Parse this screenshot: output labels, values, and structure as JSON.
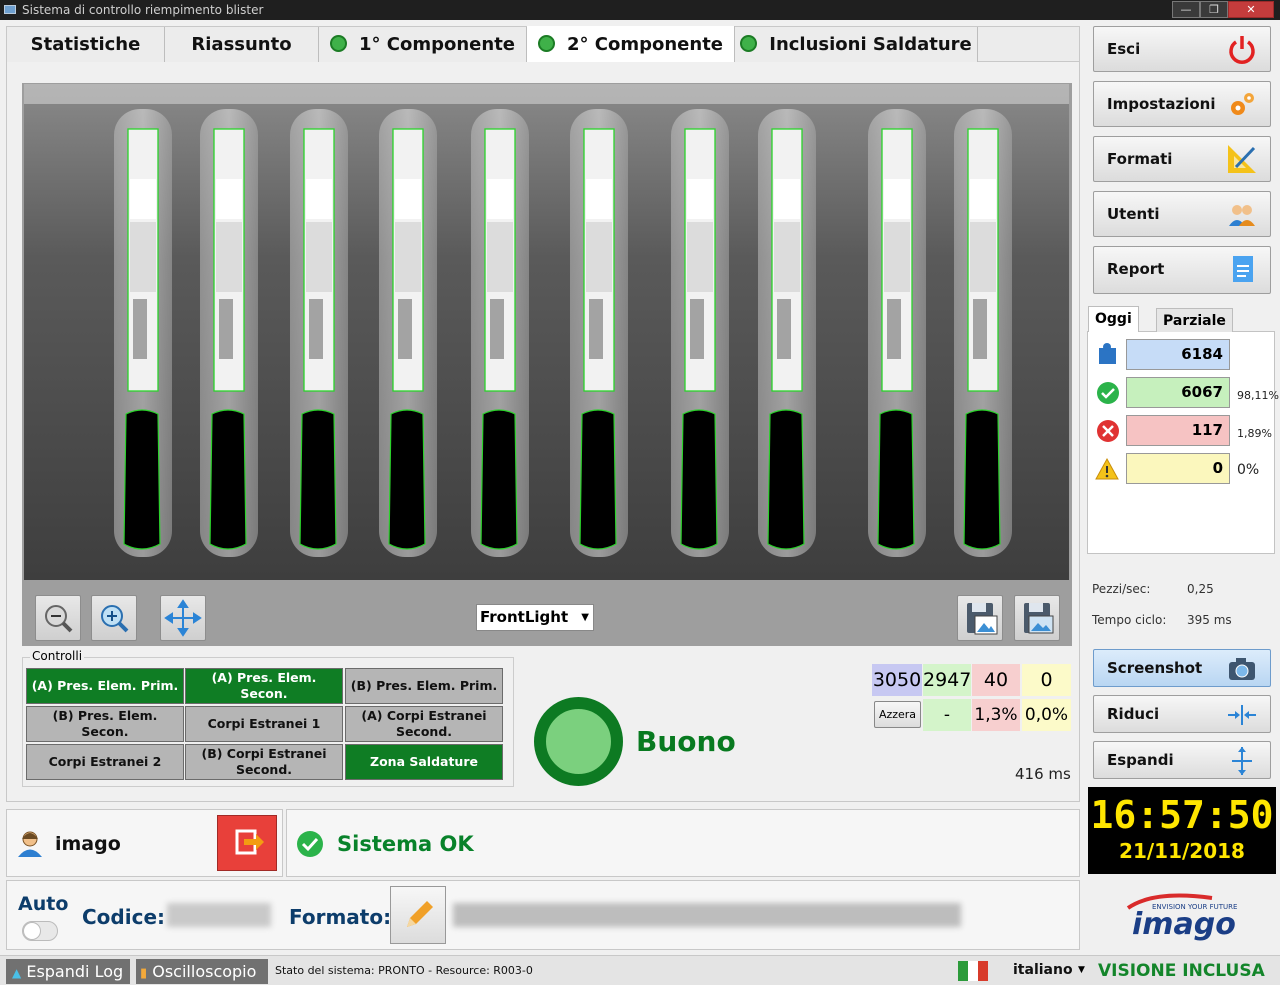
{
  "window": {
    "title": "Sistema di controllo riempimento blister"
  },
  "tabs": [
    {
      "label": "Statistiche",
      "status": "none"
    },
    {
      "label": "Riassunto",
      "status": "none"
    },
    {
      "label": "1° Componente",
      "status": "ok"
    },
    {
      "label": "2° Componente",
      "status": "ok",
      "active": true
    },
    {
      "label": "Inclusioni Saldature",
      "status": "ok"
    }
  ],
  "viewer": {
    "light_select": "FrontLight",
    "tools": [
      "zoom-out-icon",
      "zoom-in-icon",
      "fit-icon",
      "save-image-icon",
      "save-all-icon"
    ]
  },
  "controlli": {
    "title": "Controlli",
    "items": [
      {
        "label": "(A) Pres. Elem. Prim.",
        "state": "active"
      },
      {
        "label": "(A) Pres. Elem. Secon.",
        "state": "active"
      },
      {
        "label": "(B) Pres. Elem. Prim.",
        "state": "inactive"
      },
      {
        "label": "(B) Pres. Elem. Secon.",
        "state": "inactive"
      },
      {
        "label": "Corpi Estranei 1",
        "state": "inactive"
      },
      {
        "label": "(A) Corpi Estranei Second.",
        "state": "inactive"
      },
      {
        "label": "Corpi Estranei 2",
        "state": "inactive"
      },
      {
        "label": "(B) Corpi Estranei Second.",
        "state": "inactive"
      },
      {
        "label": "Zona Saldature",
        "state": "active"
      }
    ]
  },
  "result": {
    "label": "Buono",
    "color": "#0d7a22"
  },
  "counters": {
    "total": "3050",
    "good": "2947",
    "bad": "40",
    "warn": "0",
    "reset_label": "Azzera",
    "good_pct": "-",
    "bad_pct": "1,3%",
    "warn_pct": "0,0%",
    "time": "416 ms"
  },
  "user": {
    "name": "imago"
  },
  "system": {
    "status": "Sistema OK"
  },
  "codice": {
    "auto_label": "Auto",
    "codice_label": "Codice:",
    "formato_label": "Formato:"
  },
  "statusbar": {
    "log_label": "Espandi Log",
    "osc_label": "Oscilloscopio",
    "status_text": "Stato del sistema: PRONTO - Resource: R003-0",
    "language": "italiano",
    "edition": "VISIONE INCLUSA"
  },
  "sidebar": {
    "buttons": [
      {
        "label": "Esci",
        "icon": "power-icon"
      },
      {
        "label": "Impostazioni",
        "icon": "gears-icon"
      },
      {
        "label": "Formati",
        "icon": "ruler-icon"
      },
      {
        "label": "Utenti",
        "icon": "users-icon"
      },
      {
        "label": "Report",
        "icon": "report-icon"
      }
    ],
    "stats_tabs": [
      "Oggi",
      "Parziale"
    ],
    "stats": [
      {
        "value": "6184",
        "pct": "",
        "color": "#c6dcf7"
      },
      {
        "value": "6067",
        "pct": "98,11%",
        "color": "#c6f0bd"
      },
      {
        "value": "117",
        "pct": "1,89%",
        "color": "#f6c3c3"
      },
      {
        "value": "0",
        "pct": "0%",
        "color": "#fbf7bd"
      }
    ],
    "pezzi_label": "Pezzi/sec:",
    "pezzi_value": "0,25",
    "ciclo_label": "Tempo ciclo:",
    "ciclo_value": "395 ms",
    "actions": [
      {
        "label": "Screenshot",
        "icon": "camera-icon"
      },
      {
        "label": "Riduci",
        "icon": "collapse-icon"
      },
      {
        "label": "Espandi",
        "icon": "expand-icon"
      }
    ],
    "clock_time": "16:57:50",
    "clock_date": "21/11/2018",
    "logo_tagline": "ENVISION YOUR FUTURE",
    "logo_text": "imago"
  }
}
